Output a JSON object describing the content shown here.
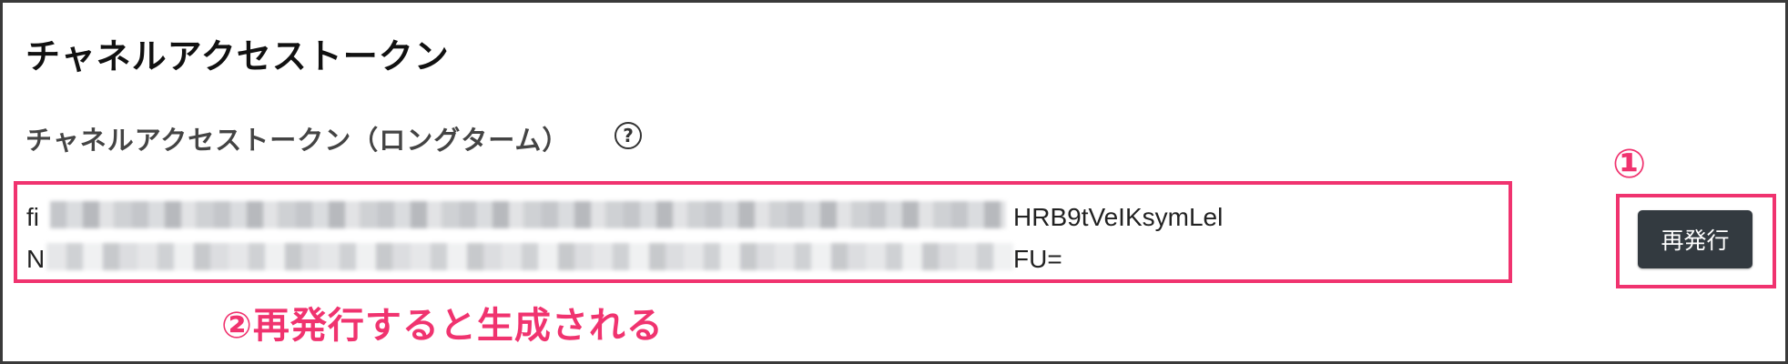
{
  "header": {
    "title": "チャネルアクセストークン"
  },
  "token_section": {
    "label": "チャネルアクセストークン（ロングターム）",
    "help_icon": "question-circle-icon",
    "token": {
      "line1_visible_start": "fi",
      "line1_visible_end": "HRB9tVeIKsymLel",
      "line2_visible_start": "N",
      "line2_visible_end": "FU=",
      "middle_redacted": true
    }
  },
  "actions": {
    "reissue_label": "再発行"
  },
  "annotations": {
    "step1": "①",
    "step2": "②再発行すると生成される",
    "highlight_color": "#f0336f"
  },
  "colors": {
    "button_bg": "#333a40",
    "accent": "#f0336f",
    "text": "#111111"
  }
}
